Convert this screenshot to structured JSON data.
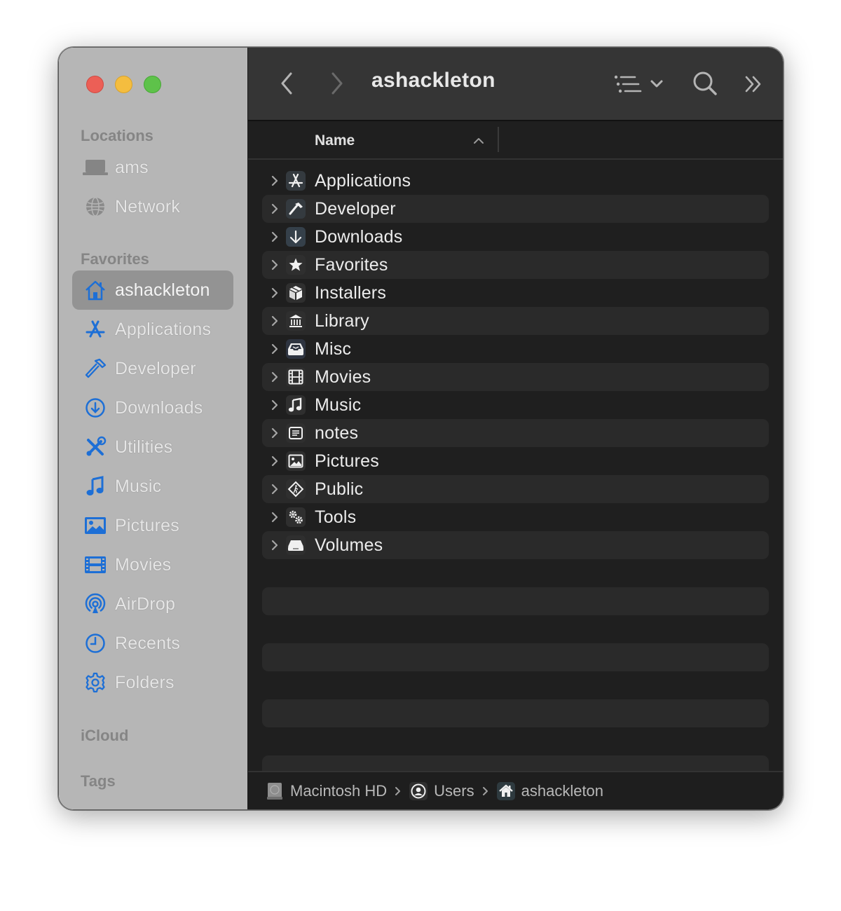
{
  "window": {
    "title": "ashackleton"
  },
  "sidebar": {
    "sections": {
      "locations": "Locations",
      "favorites": "Favorites",
      "icloud": "iCloud",
      "tags": "Tags"
    },
    "locations": [
      {
        "label": "ams",
        "icon": "laptop-icon"
      },
      {
        "label": "Network",
        "icon": "globe-icon"
      }
    ],
    "favorites": [
      {
        "label": "ashackleton",
        "icon": "home-icon",
        "selected": true
      },
      {
        "label": "Applications",
        "icon": "app-store-icon"
      },
      {
        "label": "Developer",
        "icon": "hammer-icon"
      },
      {
        "label": "Downloads",
        "icon": "download-circle-icon"
      },
      {
        "label": "Utilities",
        "icon": "tools-icon"
      },
      {
        "label": "Music",
        "icon": "music-note-icon"
      },
      {
        "label": "Pictures",
        "icon": "photo-icon"
      },
      {
        "label": "Movies",
        "icon": "film-icon"
      },
      {
        "label": "AirDrop",
        "icon": "airdrop-icon"
      },
      {
        "label": "Recents",
        "icon": "clock-icon"
      },
      {
        "label": "Folders",
        "icon": "gear-icon"
      }
    ],
    "accent_color": "#1d6fd6"
  },
  "toolbar": {
    "back_icon": "chevron-left-icon",
    "forward_icon": "chevron-right-icon",
    "view_icon": "list-view-icon",
    "view_menu_icon": "chevron-down-icon",
    "search_icon": "search-icon",
    "overflow_icon": "double-chevron-right-icon"
  },
  "columns": {
    "name": "Name",
    "sort": "ascending"
  },
  "files": [
    {
      "name": "Applications",
      "icon": "app-store-icon"
    },
    {
      "name": "Developer",
      "icon": "hammer-icon"
    },
    {
      "name": "Downloads",
      "icon": "arrow-down-icon"
    },
    {
      "name": "Favorites",
      "icon": "star-icon"
    },
    {
      "name": "Installers",
      "icon": "package-icon"
    },
    {
      "name": "Library",
      "icon": "bank-icon"
    },
    {
      "name": "Misc",
      "icon": "tray-icon"
    },
    {
      "name": "Movies",
      "icon": "film-icon"
    },
    {
      "name": "Music",
      "icon": "music-note-icon"
    },
    {
      "name": "notes",
      "icon": "document-icon"
    },
    {
      "name": "Pictures",
      "icon": "photo-icon"
    },
    {
      "name": "Public",
      "icon": "public-sign-icon"
    },
    {
      "name": "Tools",
      "icon": "gears-icon"
    },
    {
      "name": "Volumes",
      "icon": "drive-icon"
    }
  ],
  "pathbar": [
    {
      "label": "Macintosh HD",
      "icon": "hard-disk-icon"
    },
    {
      "label": "Users",
      "icon": "user-circle-icon"
    },
    {
      "label": "ashackleton",
      "icon": "home-icon"
    }
  ]
}
